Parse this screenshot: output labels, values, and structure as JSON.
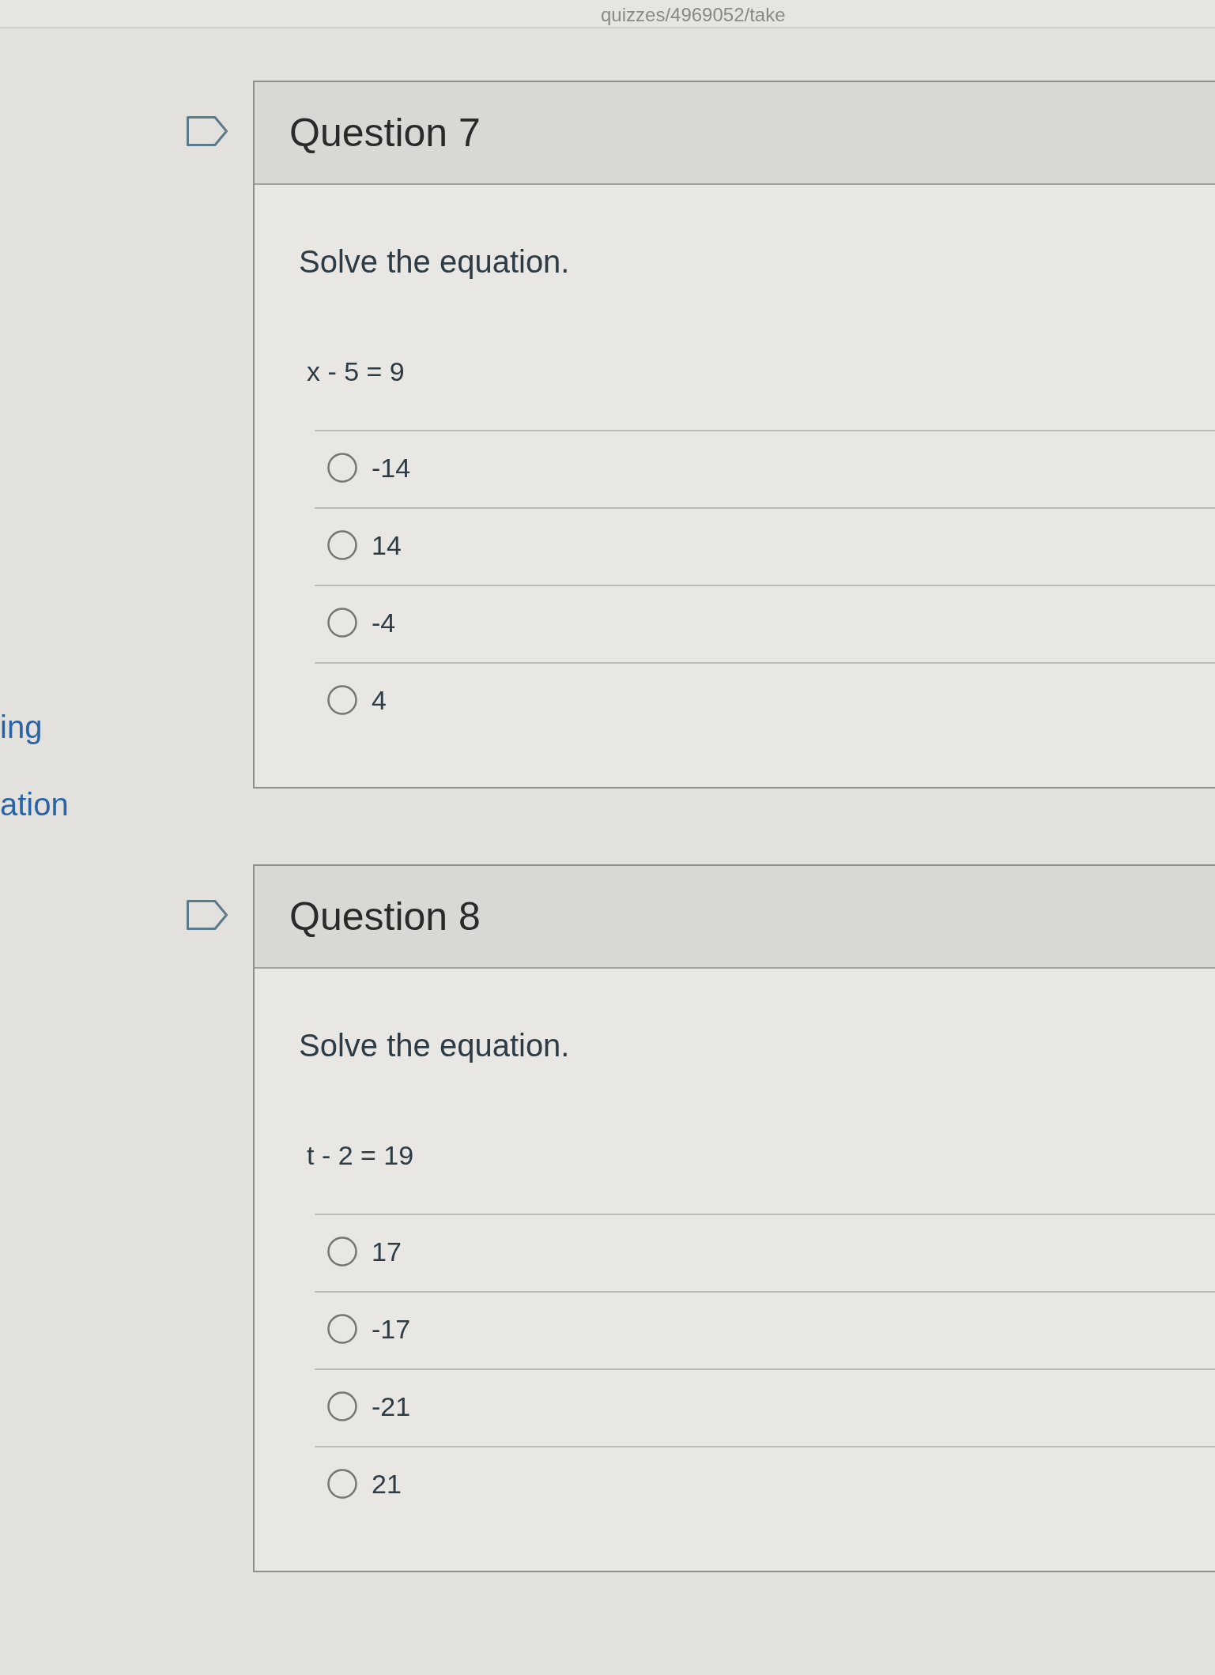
{
  "address_bar": {
    "url": "quizzes/4969052/take"
  },
  "sidebar": {
    "items": [
      {
        "label": "ing"
      },
      {
        "label": "ation"
      }
    ]
  },
  "questions": [
    {
      "title": "Question 7",
      "flagged": false,
      "prompt": "Solve the equation.",
      "equation": "x - 5 = 9",
      "answers": [
        {
          "label": "-14",
          "selected": false
        },
        {
          "label": "14",
          "selected": false
        },
        {
          "label": "-4",
          "selected": false
        },
        {
          "label": "4",
          "selected": false
        }
      ]
    },
    {
      "title": "Question 8",
      "flagged": false,
      "prompt": "Solve the equation.",
      "equation": "t - 2 = 19",
      "answers": [
        {
          "label": "17",
          "selected": false
        },
        {
          "label": "-17",
          "selected": false
        },
        {
          "label": "-21",
          "selected": false
        },
        {
          "label": "21",
          "selected": false
        }
      ]
    }
  ]
}
